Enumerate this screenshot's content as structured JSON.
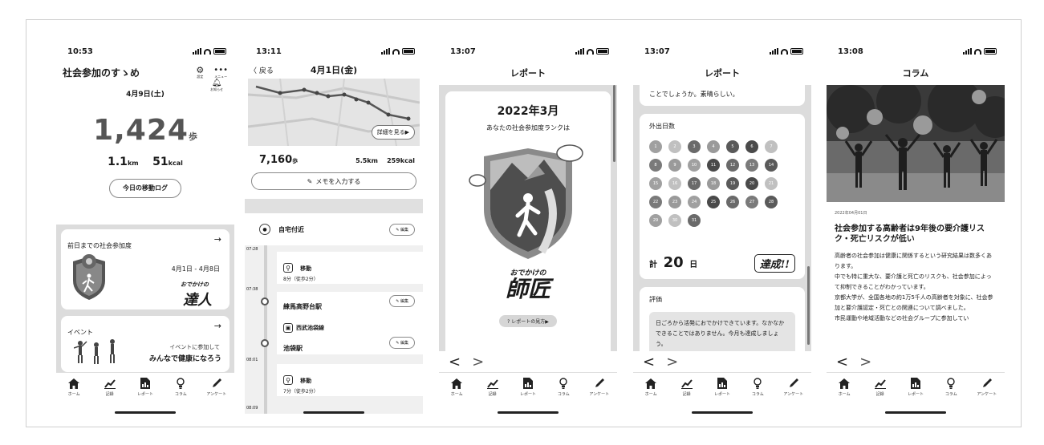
{
  "tabs": [
    {
      "label": "ホーム",
      "icon": "home-icon"
    },
    {
      "label": "記録",
      "icon": "chart-icon"
    },
    {
      "label": "レポート",
      "icon": "report-icon"
    },
    {
      "label": "コラム",
      "icon": "bulb-icon"
    },
    {
      "label": "アンケート",
      "icon": "pencil-icon"
    }
  ],
  "home": {
    "time": "10:53",
    "app_title": "社会参加のすゝめ",
    "settings_label": "設定",
    "menu_label": "メニュー",
    "notify_label": "お知らせ",
    "date": "4月9日(土)",
    "steps": "1,424",
    "steps_unit": "歩",
    "km": "1.1",
    "km_unit": "km",
    "kcal": "51",
    "kcal_unit": "kcal",
    "log_button": "今日の移動ログ",
    "card1_title": "前日までの社会参加度",
    "card1_range": "4月1日 - 4月8日",
    "card1_rank_small": "おでかけの",
    "card1_rank_big": "達人",
    "card2_title": "イベント",
    "card2_line1": "イベントに参加して",
    "card2_line2": "みんなで健康になろう"
  },
  "log": {
    "time": "13:11",
    "back": "戻る",
    "title": "4月1日(金)",
    "map_button": "詳細を見る▶",
    "steps": "7,160",
    "steps_unit": "歩",
    "km": "5.5km",
    "kcal": "259kcal",
    "memo": "メモを入力する",
    "edit": "編集",
    "place_home": "自宅付近",
    "t1": "07:28",
    "move1": "移動",
    "move1_sub": "8分（徒歩2分）",
    "t2": "07:38",
    "station1": "練馬高野台駅",
    "line": "西武池袋線",
    "station2": "池袋駅",
    "t3": "08:01",
    "move2": "移動",
    "move2_sub": "7分（徒歩2分）",
    "t4": "08:09"
  },
  "report1": {
    "time": "13:07",
    "title": "レポート",
    "month": "2022年3月",
    "subtitle": "あなたの社会参加度ランクは",
    "rank_small": "おでかけの",
    "rank_big": "師匠",
    "guide": "? レポートの見方▶"
  },
  "report2": {
    "time": "13:07",
    "title": "レポート",
    "top_text": "ことでしょうか。素晴らしい。",
    "days_label": "外出日数",
    "days": [
      "1",
      "2",
      "3",
      "4",
      "5",
      "6",
      "7",
      "8",
      "9",
      "10",
      "11",
      "12",
      "13",
      "14",
      "15",
      "16",
      "17",
      "18",
      "19",
      "20",
      "21",
      "22",
      "23",
      "24",
      "25",
      "26",
      "27",
      "28",
      "29",
      "30",
      "31"
    ],
    "total_prefix": "計",
    "total": "20",
    "total_unit": "日",
    "stamp": "達成!!",
    "eval_label": "評価",
    "eval_text": "日ごろから活発におでかけできています。なかなかできることではありません。今月も達成しましょう。"
  },
  "column": {
    "time": "13:08",
    "title": "コラム",
    "date": "2022年04月01日",
    "headline": "社会参加する高齢者は9年後の要介護リスク・死亡リスクが低い",
    "p1": "高齢者の社会参加は健康に関係するという研究結果は数多くあります。",
    "p2": "中でも特に重大な、要介護と死亡のリスクも、社会参加によって抑制できることがわかっています。",
    "p3": "京都大学が、全国各地の約1万5千人の高齢者を対象に、社会参加と要介護認定・死亡との関連について調べました。",
    "p4": "市民運動や地域活動などの社会グループに参加してい"
  },
  "nav": {
    "prev": "<",
    "next": ">"
  }
}
